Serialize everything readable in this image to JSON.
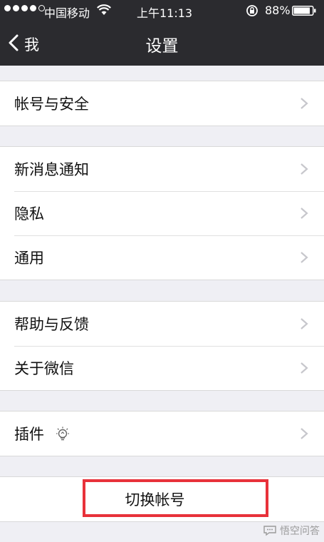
{
  "status_bar": {
    "carrier": "中国移动",
    "time": "上午11:13",
    "battery_percent": "88%",
    "signal_strength": 4
  },
  "nav": {
    "back_label": "我",
    "title": "设置"
  },
  "groups": [
    {
      "items": [
        {
          "label": "帐号与安全"
        }
      ]
    },
    {
      "items": [
        {
          "label": "新消息通知"
        },
        {
          "label": "隐私"
        },
        {
          "label": "通用"
        }
      ]
    },
    {
      "items": [
        {
          "label": "帮助与反馈"
        },
        {
          "label": "关于微信"
        }
      ]
    },
    {
      "items": [
        {
          "label": "插件"
        }
      ]
    }
  ],
  "switch_account": {
    "label": "切换帐号"
  },
  "watermark": {
    "text": "悟空问答"
  },
  "colors": {
    "nav_bg": "#2b2b2f",
    "page_bg": "#efeff4",
    "highlight": "#e8313a",
    "chevron": "#c7c7cc"
  }
}
